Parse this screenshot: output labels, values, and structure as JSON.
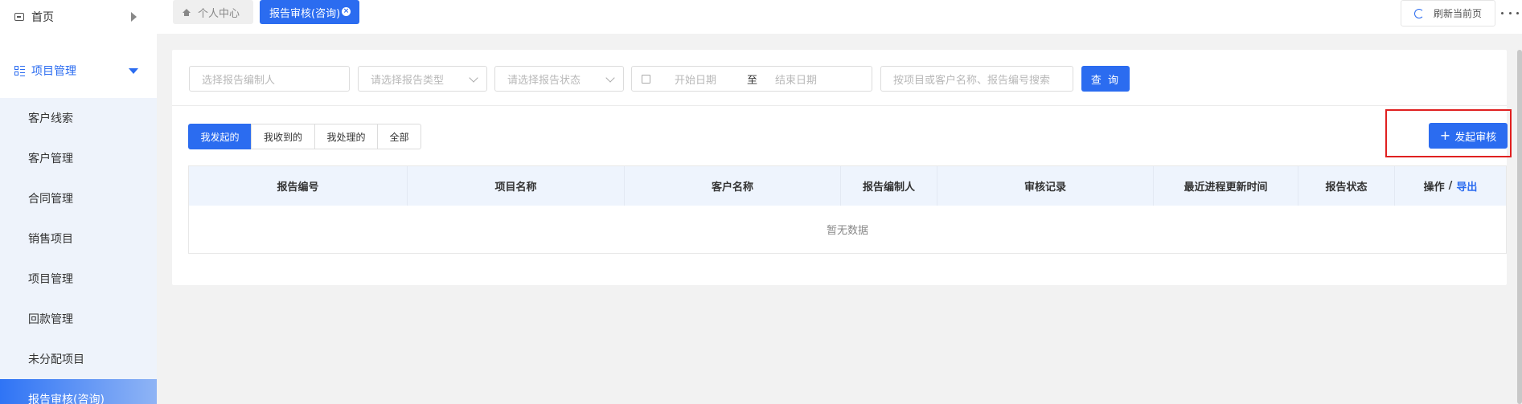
{
  "sidebar": {
    "home_label": "首页",
    "group_label": "项目管理",
    "items": [
      {
        "label": "客户线索"
      },
      {
        "label": "客户管理"
      },
      {
        "label": "合同管理"
      },
      {
        "label": "销售项目"
      },
      {
        "label": "项目管理"
      },
      {
        "label": "回款管理"
      },
      {
        "label": "未分配项目"
      },
      {
        "label": "报告审核(咨询)",
        "active": true
      }
    ]
  },
  "tabs": [
    {
      "label": "个人中心",
      "icon": "home-icon"
    },
    {
      "label": "报告审核(咨询)",
      "active": true,
      "icon": "close-icon"
    }
  ],
  "header": {
    "refresh_label": "刷新当前页",
    "more_icon": "more-dots-icon"
  },
  "filters": {
    "compiler_placeholder": "选择报告编制人",
    "type_placeholder": "请选择报告类型",
    "status_placeholder": "请选择报告状态",
    "start_date_placeholder": "开始日期",
    "date_separator": "至",
    "end_date_placeholder": "结束日期",
    "search_placeholder": "按项目或客户名称、报告编号搜索",
    "query_label": "查 询"
  },
  "view_tabs": [
    {
      "label": "我发起的",
      "active": true
    },
    {
      "label": "我收到的"
    },
    {
      "label": "我处理的"
    },
    {
      "label": "全部"
    }
  ],
  "add_button_label": "发起审核",
  "table": {
    "columns": [
      {
        "label": "报告编号"
      },
      {
        "label": "项目名称"
      },
      {
        "label": "客户名称"
      },
      {
        "label": "报告编制人"
      },
      {
        "label": "审核记录"
      },
      {
        "label": "最近进程更新时间"
      },
      {
        "label": "报告状态"
      },
      {
        "label": "操作"
      }
    ],
    "export_label": "导出",
    "slash": "/",
    "empty_text": "暂无数据"
  },
  "colors": {
    "accent": "#2b6cf0",
    "highlight": "#e02020"
  }
}
